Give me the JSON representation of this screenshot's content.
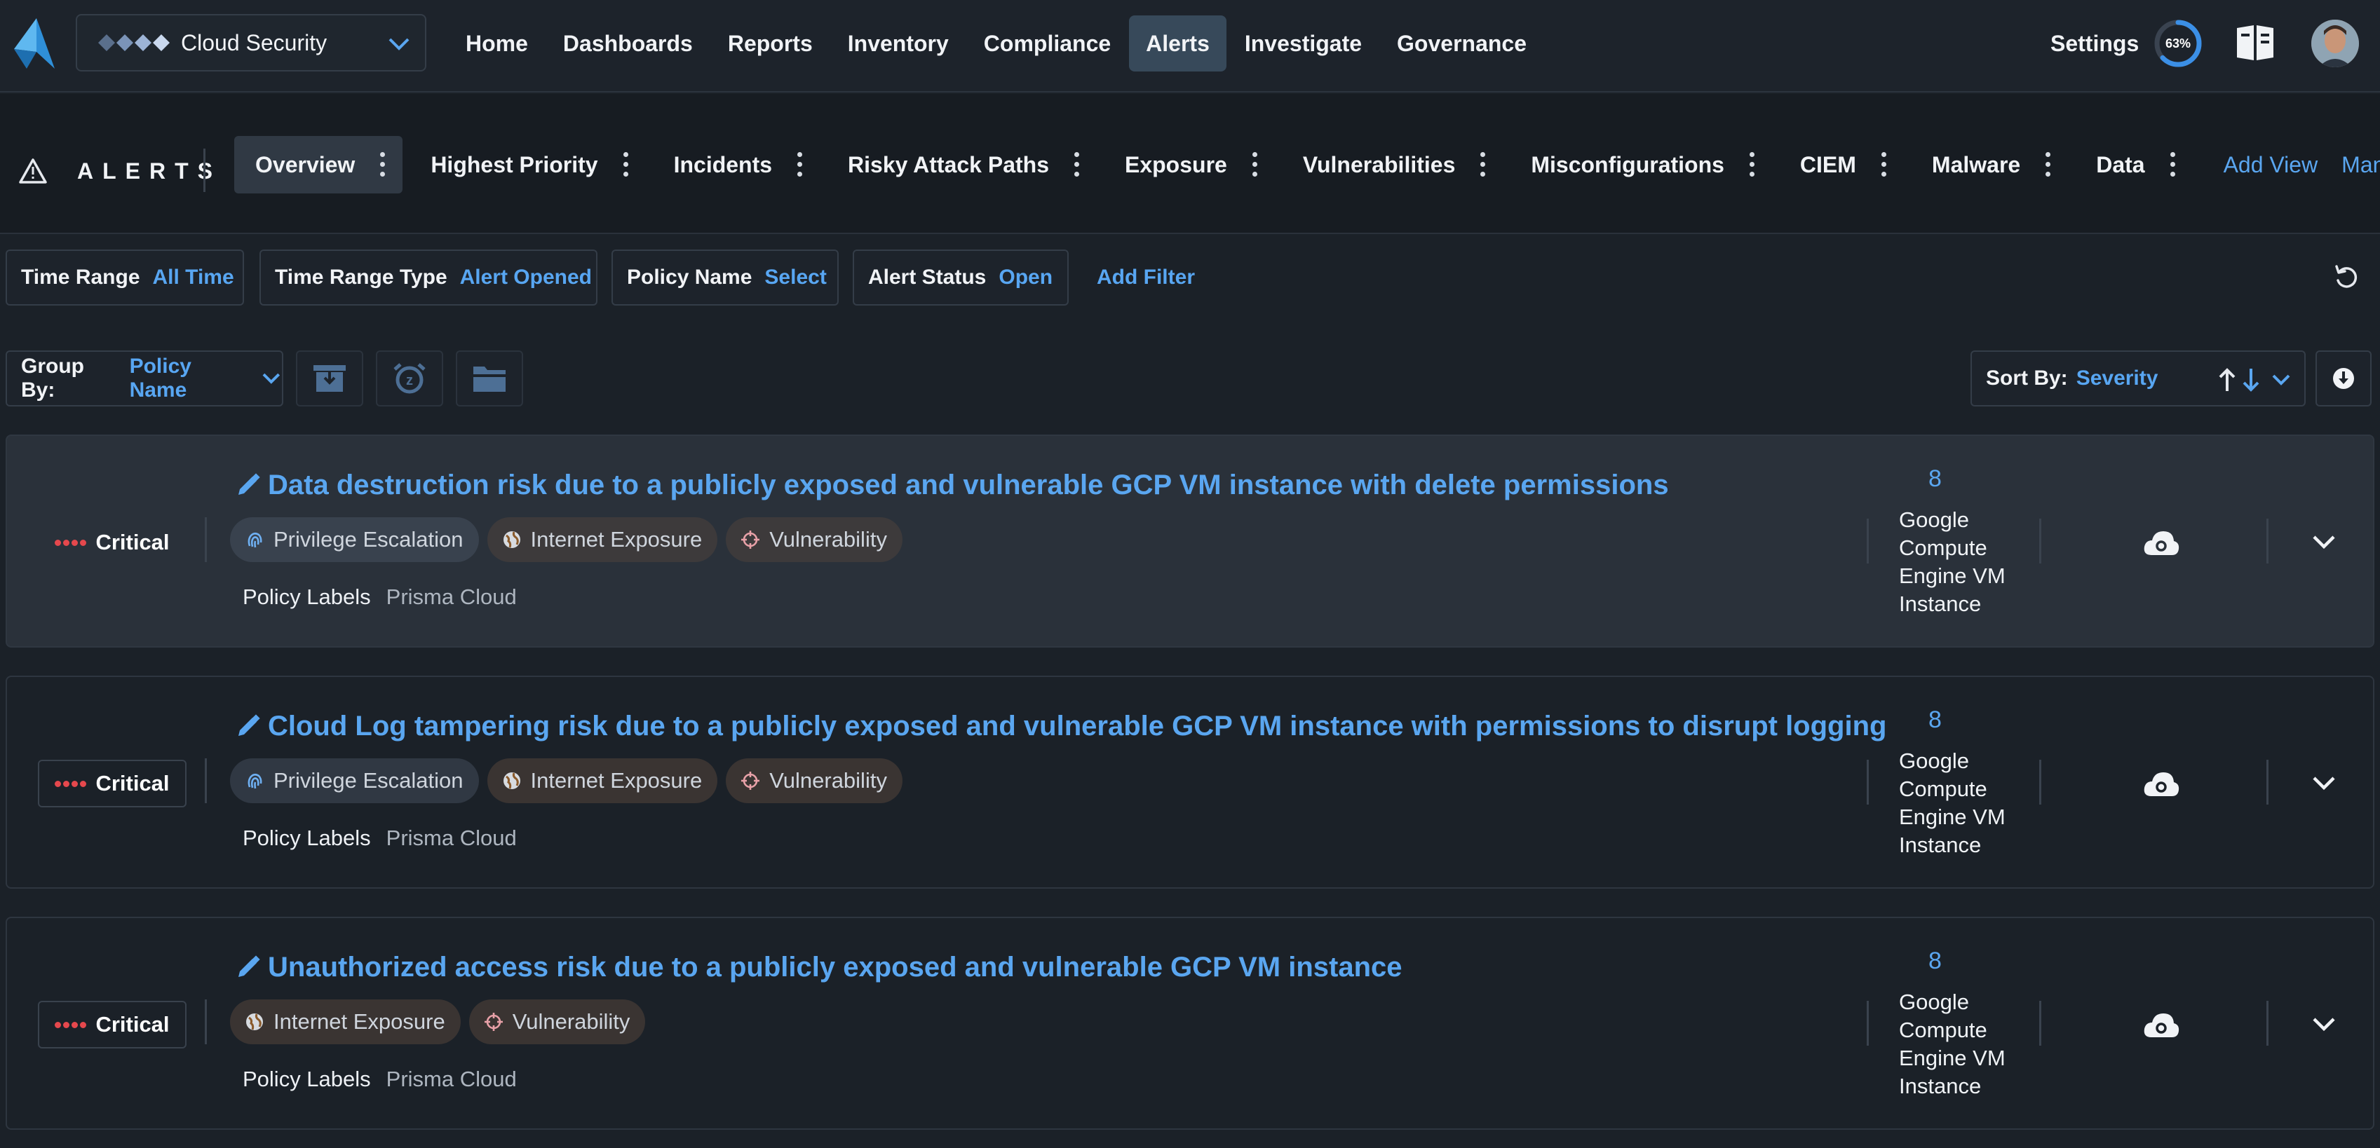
{
  "topbar": {
    "product_switcher": {
      "name": "Cloud Security"
    },
    "nav": [
      "Home",
      "Dashboards",
      "Reports",
      "Inventory",
      "Compliance",
      "Alerts",
      "Investigate",
      "Governance"
    ],
    "active_nav": "Alerts",
    "settings_label": "Settings",
    "progress_text": "63%",
    "progress_value": 0.63
  },
  "subnav": {
    "title": "ALERTS",
    "views": [
      "Overview",
      "Highest Priority",
      "Incidents",
      "Risky Attack Paths",
      "Exposure",
      "Vulnerabilities",
      "Misconfigurations",
      "CIEM",
      "Malware",
      "Data"
    ],
    "active_view": "Overview",
    "add_view": "Add View",
    "manage_views": "Manage Vie"
  },
  "filters": [
    {
      "key": "Time Range",
      "value": "All Time"
    },
    {
      "key": "Time Range Type",
      "value": "Alert Opened"
    },
    {
      "key": "Policy Name",
      "value": "Select"
    },
    {
      "key": "Alert Status",
      "value": "Open"
    }
  ],
  "add_filter": "Add Filter",
  "toolbar": {
    "group_by_label": "Group By:",
    "group_by_value": "Policy Name",
    "sort_by_label": "Sort By:",
    "sort_by_value": "Severity"
  },
  "alerts": [
    {
      "severity": "Critical",
      "title": "Data destruction risk due to a publicly exposed and vulnerable GCP VM instance with delete permissions",
      "tags": [
        "Privilege Escalation",
        "Internet Exposure",
        "Vulnerability"
      ],
      "policy_labels_key": "Policy Labels",
      "policy_labels": "Prisma Cloud",
      "count": "8",
      "resource_type": "Google Compute Engine VM Instance"
    },
    {
      "severity": "Critical",
      "title": "Cloud Log tampering risk due to a publicly exposed and vulnerable GCP VM instance with permissions to disrupt logging",
      "tags": [
        "Privilege Escalation",
        "Internet Exposure",
        "Vulnerability"
      ],
      "policy_labels_key": "Policy Labels",
      "policy_labels": "Prisma Cloud",
      "count": "8",
      "resource_type": "Google Compute Engine VM Instance"
    },
    {
      "severity": "Critical",
      "title": "Unauthorized access risk due to a publicly exposed and vulnerable GCP VM instance",
      "tags": [
        "Internet Exposure",
        "Vulnerability"
      ],
      "policy_labels_key": "Policy Labels",
      "policy_labels": "Prisma Cloud",
      "count": "8",
      "resource_type": "Google Compute Engine VM Instance"
    }
  ],
  "colors": {
    "accent": "#58a6f2",
    "critical": "#e5484d",
    "background": "#1b2128"
  },
  "icons": {
    "tag_icons": {
      "Privilege Escalation": "fingerprint-icon",
      "Internet Exposure": "globe-icon",
      "Vulnerability": "crosshair-icon"
    },
    "resource_icon": "cloud-icon"
  }
}
